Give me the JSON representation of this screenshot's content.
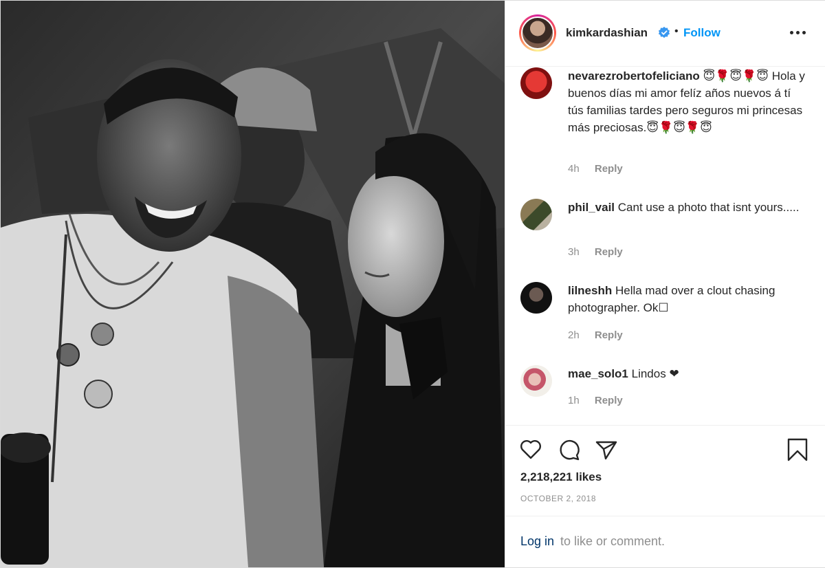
{
  "post": {
    "image_alt": "",
    "header": {
      "username": "kimkardashian",
      "separator": "•",
      "follow_label": "Follow",
      "verified_icon": "verified-badge-icon",
      "more_icon": "more-options-icon"
    },
    "comments": [
      {
        "username": "nevarezrobertofeliciano",
        "text": "😇🌹😇🌹😇 Hola y buenos días mi amor felíz años nuevos á tí tús familias tardes pero seguros mi princesas más preciosas.😇🌹😇🌹😇",
        "time": "4h",
        "reply_label": "Reply"
      },
      {
        "username": "phil_vail",
        "text": "Cant use a photo that isnt yours.....",
        "time": "3h",
        "reply_label": "Reply"
      },
      {
        "username": "lilneshh",
        "text": "Hella mad over a clout chasing photographer. Ok☐",
        "time": "2h",
        "reply_label": "Reply"
      },
      {
        "username": "mae_solo1",
        "text": "Lindos ❤",
        "time": "1h",
        "reply_label": "Reply"
      }
    ],
    "actions": {
      "like_icon": "heart-icon",
      "comment_icon": "comment-icon",
      "share_icon": "share-icon",
      "save_icon": "bookmark-icon"
    },
    "likes": "2,218,221 likes",
    "date": "OCTOBER 2, 2018",
    "login_link": "Log in",
    "login_rest": "to like or comment."
  }
}
